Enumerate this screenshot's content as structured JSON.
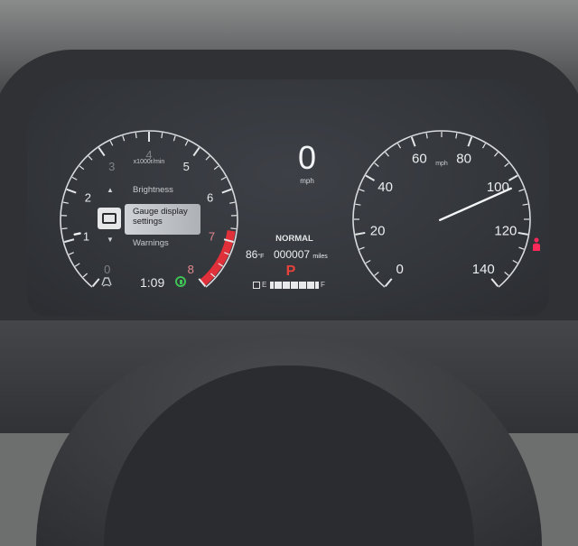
{
  "tachometer": {
    "ticks": [
      "0",
      "1",
      "2",
      "3",
      "4",
      "5",
      "6",
      "7",
      "8"
    ],
    "unit_label": "x1000r/min",
    "needle_value": 1.1,
    "redline_start": 6.8
  },
  "menu": {
    "items": [
      "Brightness",
      "Gauge display settings",
      "Warnings"
    ]
  },
  "status": {
    "time": "1:09",
    "icons": [
      "traction-control-icon",
      "eco-icon"
    ]
  },
  "center": {
    "speed": "0",
    "speed_unit": "mph",
    "drive_mode": "NORMAL",
    "outside_temp": "86",
    "temp_unit": "°F",
    "odometer": "000007",
    "odometer_unit": "miles",
    "gear": "P",
    "fuel": {
      "empty_label": "E",
      "full_label": "F",
      "level_fraction": 1.0,
      "segments": 12
    }
  },
  "speedometer": {
    "ticks": [
      "0",
      "20",
      "40",
      "60",
      "80",
      "100",
      "120",
      "140"
    ],
    "unit_label": "mph",
    "needle_value": 103
  },
  "colors": {
    "redline": "#e0303a",
    "gear_p": "#e6423a",
    "eco": "#3fc156",
    "seatbelt_warning": "#ff2a5a"
  }
}
